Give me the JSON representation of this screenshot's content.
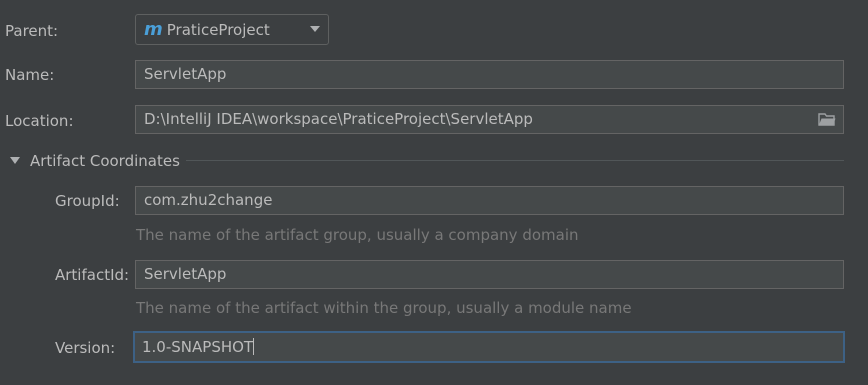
{
  "parent": {
    "label": "Parent:",
    "value": "PraticeProject",
    "icon": "maven-m-icon"
  },
  "name": {
    "label": "Name:",
    "value": "ServletApp"
  },
  "location": {
    "label": "Location:",
    "value": "D:\\IntelliJ IDEA\\workspace\\PraticeProject\\ServletApp",
    "icon": "folder-icon"
  },
  "artifact_section": {
    "title": "Artifact Coordinates",
    "group_id": {
      "label": "GroupId:",
      "value": "com.zhu2change",
      "hint": "The name of the artifact group, usually a company domain"
    },
    "artifact_id": {
      "label": "ArtifactId:",
      "value": "ServletApp",
      "hint": "The name of the artifact within the group, usually a module name"
    },
    "version": {
      "label": "Version:",
      "value": "1.0-SNAPSHOT"
    }
  },
  "colors": {
    "background": "#3c3f41",
    "field_background": "#45494a",
    "focus_border": "#3d6185",
    "maven_icon": "#4a9fd8"
  }
}
